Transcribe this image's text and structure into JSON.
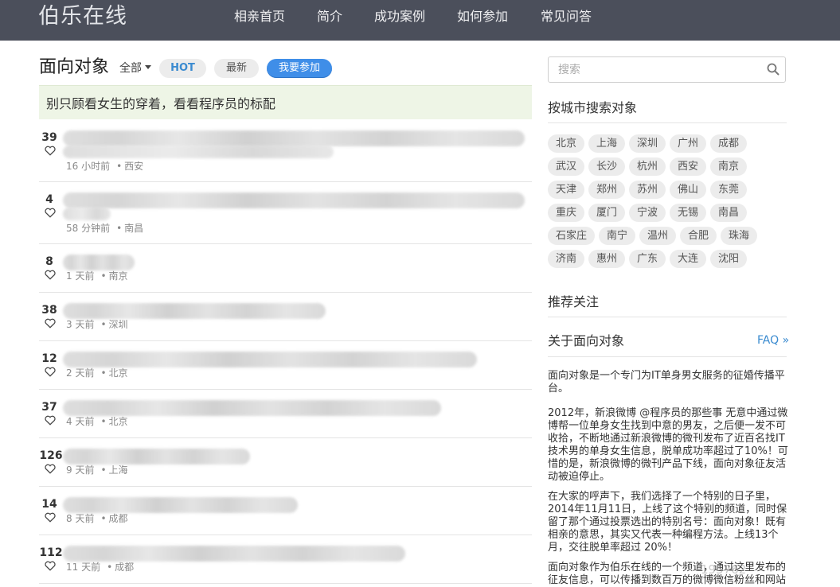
{
  "nav": {
    "brand": "伯乐在线",
    "items": [
      "相亲首页",
      "简介",
      "成功案例",
      "如何参加",
      "常见问答"
    ]
  },
  "main": {
    "title": "面向对象",
    "filter_label": "全部",
    "tabs": {
      "hot": "HOT",
      "new": "最新"
    },
    "join_button": "我要参加",
    "banner": "别只顾看女生的穿着，看看程序员的标配",
    "posts": [
      {
        "votes": "39",
        "time": "16 小时前",
        "city": "西安"
      },
      {
        "votes": "4",
        "time": "58 分钟前",
        "city": "南昌"
      },
      {
        "votes": "8",
        "time": "1 天前",
        "city": "南京"
      },
      {
        "votes": "38",
        "time": "3 天前",
        "city": "深圳"
      },
      {
        "votes": "12",
        "time": "2 天前",
        "city": "北京"
      },
      {
        "votes": "37",
        "time": "4 天前",
        "city": "北京"
      },
      {
        "votes": "126",
        "time": "9 天前",
        "city": "上海"
      },
      {
        "votes": "14",
        "time": "8 天前",
        "city": "成都"
      },
      {
        "votes": "112",
        "time": "11 天前",
        "city": "成都"
      }
    ]
  },
  "sidebar": {
    "search_placeholder": "搜索",
    "city_heading": "按城市搜索对象",
    "cities": [
      [
        "北京",
        "上海",
        "深圳",
        "广州",
        "成都"
      ],
      [
        "武汉",
        "长沙",
        "杭州",
        "西安",
        "南京"
      ],
      [
        "天津",
        "郑州",
        "苏州",
        "佛山",
        "东莞"
      ],
      [
        "重庆",
        "厦门",
        "宁波",
        "无锡",
        "南昌"
      ],
      [
        "石家庄",
        "南宁",
        "温州",
        "合肥",
        "珠海"
      ],
      [
        "济南",
        "惠州",
        "广东",
        "大连",
        "沈阳"
      ]
    ],
    "recommend_heading": "推荐关注",
    "about_heading": "关于面向对象",
    "faq_link": "FAQ »",
    "about_paragraphs": [
      "面向对象是一个专门为IT单身男女服务的征婚传播平台。",
      "2012年，新浪微博 @程序员的那些事 无意中通过微博帮一位单身女生找到中意的男友，之后便一发不可收拾，不断地通过新浪微博的微刊发布了近百名找IT技术男的单身女生信息，脱单成功率超过了10%！可惜的是，新浪微博的微刊产品下线，面向对象征友活动被迫停止。",
      "在大家的呼声下，我们选择了一个特别的日子里，2014年11月11日，上线了这个特别的频道，同时保留了那个通过投票选出的特别名号：面向对象！既有相亲的意思，其实又代表一种编程方法。上线13个月，交往脱单率超过 20%！",
      "面向对象作为伯乐在线的一个频道，通过这里发布的征友信息，可以传播到数百万的微博微信粉丝和网站"
    ]
  },
  "watermark": "195762"
}
